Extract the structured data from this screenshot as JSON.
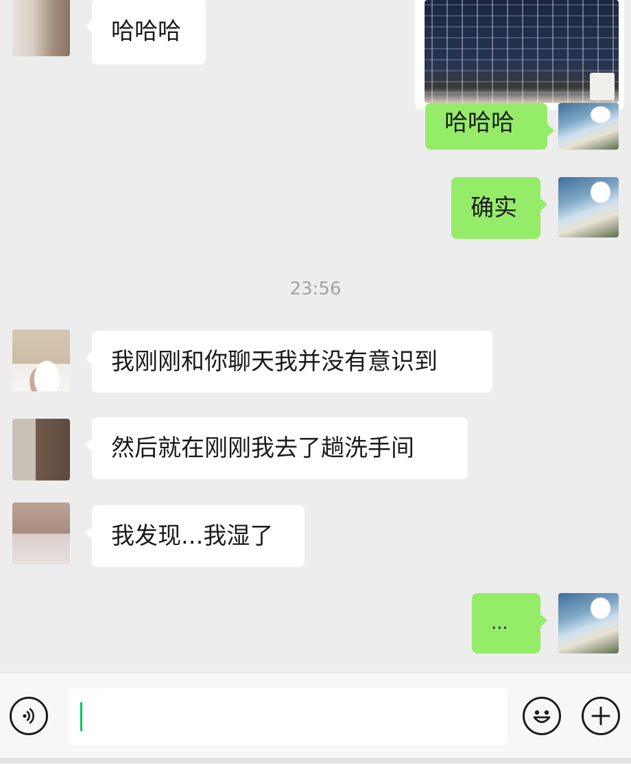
{
  "timestamp": "23:56",
  "messages": [
    {
      "side": "left",
      "text": "哈哈哈"
    },
    {
      "side": "right",
      "type": "image"
    },
    {
      "side": "right",
      "text": "哈哈哈"
    },
    {
      "side": "right",
      "text": "确实"
    },
    {
      "side": "left",
      "text": "我刚刚和你聊天我并没有意识到"
    },
    {
      "side": "left",
      "text": "然后就在刚刚我去了趟洗手间"
    },
    {
      "side": "left",
      "text": "我发现...我湿了"
    },
    {
      "side": "right",
      "text": "..."
    }
  ],
  "input": {
    "value": "",
    "icons": [
      "voice-icon",
      "emoji-icon",
      "plus-icon"
    ]
  },
  "colors": {
    "chat_background": "#ededed",
    "incoming_bubble": "#ffffff",
    "outgoing_bubble": "#95ec69",
    "cursor": "#07c160"
  }
}
